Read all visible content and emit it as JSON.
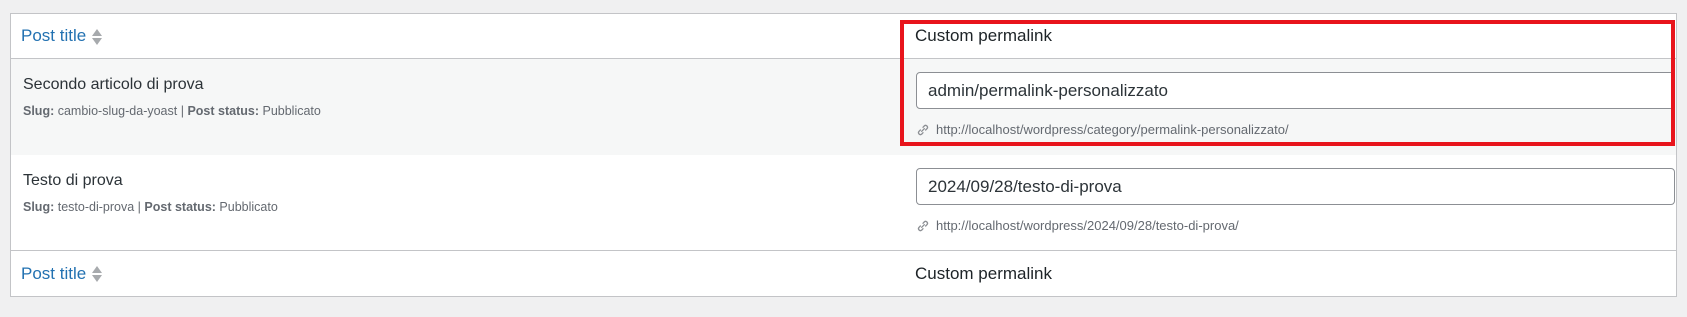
{
  "header": {
    "post_title_label": "Post title",
    "custom_permalink_label": "Custom permalink"
  },
  "footer": {
    "post_title_label": "Post title",
    "custom_permalink_label": "Custom permalink"
  },
  "labels": {
    "slug": "Slug:",
    "separator": "|",
    "post_status": "Post status:"
  },
  "rows": [
    {
      "title": "Secondo articolo di prova",
      "slug": "cambio-slug-da-yoast",
      "status": "Pubblicato",
      "permalink_value": "admin/permalink-personalizzato",
      "url": "http://localhost/wordpress/category/permalink-personalizzato/"
    },
    {
      "title": "Testo di prova",
      "slug": "testo-di-prova",
      "status": "Pubblicato",
      "permalink_value": "2024/09/28/testo-di-prova",
      "url": "http://localhost/wordpress/2024/09/28/testo-di-prova/"
    }
  ],
  "icons": {
    "sort": "sort-icon",
    "link": "link-icon"
  },
  "colors": {
    "link_blue": "#2271b1",
    "highlight_red": "#e8141c"
  }
}
